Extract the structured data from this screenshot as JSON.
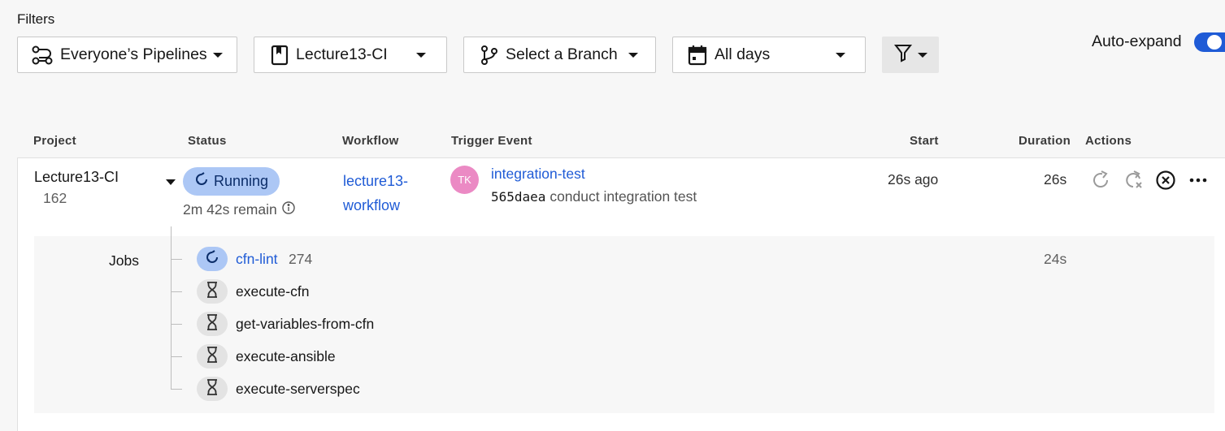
{
  "filters": {
    "title": "Filters",
    "pipelines": "Everyone’s Pipelines",
    "project": "Lecture13-CI",
    "branch": "Select a Branch",
    "days": "All days",
    "auto_expand": "Auto-expand",
    "auto_expand_on": true
  },
  "columns": {
    "project": "Project",
    "status": "Status",
    "workflow": "Workflow",
    "trigger": "Trigger Event",
    "start": "Start",
    "duration": "Duration",
    "actions": "Actions"
  },
  "pipeline": {
    "project": "Lecture13-CI",
    "number": "162",
    "status": "Running",
    "remaining": "2m 42s remain",
    "workflow_line1": "lecture13-",
    "workflow_line2": "workflow",
    "avatar_initials": "TK",
    "trigger_name": "integration-test",
    "commit_hash": "565daea",
    "commit_message": "conduct integration test",
    "start": "26s ago",
    "duration": "26s"
  },
  "jobs": {
    "label": "Jobs",
    "items": [
      {
        "name": "cfn-lint",
        "number": "274",
        "duration": "24s",
        "state": "running"
      },
      {
        "name": "execute-cfn",
        "state": "queued"
      },
      {
        "name": "get-variables-from-cfn",
        "state": "queued"
      },
      {
        "name": "execute-ansible",
        "state": "queued"
      },
      {
        "name": "execute-serverspec",
        "state": "queued"
      }
    ]
  },
  "colors": {
    "accent": "#1f5bd6",
    "running_bg": "#acc7f5",
    "avatar_bg": "#eb8ac4"
  }
}
